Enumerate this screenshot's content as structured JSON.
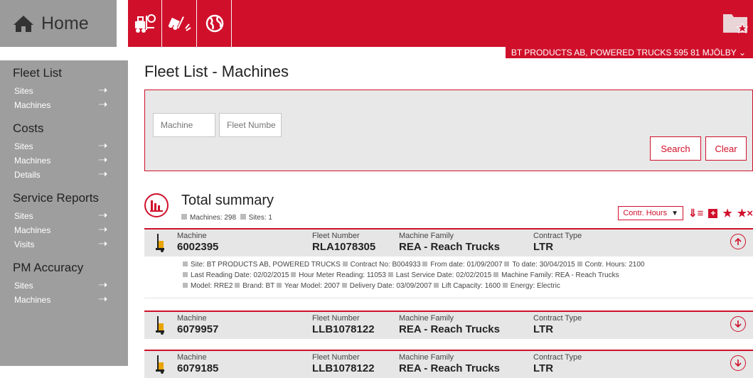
{
  "header": {
    "home_label": "Home",
    "nav_icons": [
      "forklift-search-icon",
      "forklift-damage-icon",
      "globe-icon"
    ],
    "folder_icon": "folder-star-icon",
    "owner": "BT PRODUCTS AB, POWERED TRUCKS 595 81 MJÖLBY"
  },
  "sidebar": [
    {
      "title": "Fleet List",
      "items": [
        {
          "label": "Sites"
        },
        {
          "label": "Machines"
        }
      ]
    },
    {
      "title": "Costs",
      "items": [
        {
          "label": "Sites"
        },
        {
          "label": "Machines"
        },
        {
          "label": "Details"
        }
      ]
    },
    {
      "title": "Service Reports",
      "items": [
        {
          "label": "Sites"
        },
        {
          "label": "Machines"
        },
        {
          "label": "Visits"
        }
      ]
    },
    {
      "title": "PM Accuracy",
      "items": [
        {
          "label": "Sites"
        },
        {
          "label": "Machines"
        }
      ]
    }
  ],
  "page": {
    "title": "Fleet List - Machines"
  },
  "filter": {
    "machine_placeholder": "Machine",
    "fleet_placeholder": "Fleet Numbe",
    "search_label": "Search",
    "clear_label": "Clear"
  },
  "summary": {
    "title": "Total summary",
    "machines_label": "Machines:",
    "machines_value": "298",
    "sites_label": "Sites:",
    "sites_value": "1",
    "sort_value": "Contr. Hours"
  },
  "columns": {
    "machine": "Machine",
    "fleet": "Fleet Number",
    "family": "Machine Family",
    "contract": "Contract Type"
  },
  "machines": [
    {
      "machine": "6002395",
      "fleet": "RLA1078305",
      "family": "REA - Reach Trucks",
      "contract": "LTR",
      "expanded": true,
      "details": [
        [
          {
            "k": "Site:",
            "v": "BT PRODUCTS AB, POWERED TRUCKS"
          },
          {
            "k": "Contract No:",
            "v": "B004933"
          },
          {
            "k": "From date:",
            "v": "01/09/2007"
          },
          {
            "k": "To date:",
            "v": "30/04/2015"
          },
          {
            "k": "Contr. Hours:",
            "v": "2100"
          }
        ],
        [
          {
            "k": "Last Reading Date:",
            "v": "02/02/2015"
          },
          {
            "k": "Hour Meter Reading:",
            "v": "11053"
          },
          {
            "k": "Last Service Date:",
            "v": "02/02/2015"
          },
          {
            "k": "Machine Family:",
            "v": "REA - Reach Trucks"
          }
        ],
        [
          {
            "k": "Model:",
            "v": "RRE2"
          },
          {
            "k": "Brand:",
            "v": "BT"
          },
          {
            "k": "Year Model:",
            "v": "2007"
          },
          {
            "k": "Delivery Date:",
            "v": "03/09/2007"
          },
          {
            "k": "Lift Capacity:",
            "v": "1600"
          },
          {
            "k": "Energy:",
            "v": "Electric"
          }
        ]
      ]
    },
    {
      "machine": "6079957",
      "fleet": "LLB1078122",
      "family": "REA - Reach Trucks",
      "contract": "LTR",
      "expanded": false
    },
    {
      "machine": "6079185",
      "fleet": "LLB1078122",
      "family": "REA - Reach Trucks",
      "contract": "LTR",
      "expanded": false
    }
  ],
  "colors": {
    "accent": "#d0102b",
    "sidebar": "#9e9e9e",
    "panel": "#e8e8e8"
  }
}
